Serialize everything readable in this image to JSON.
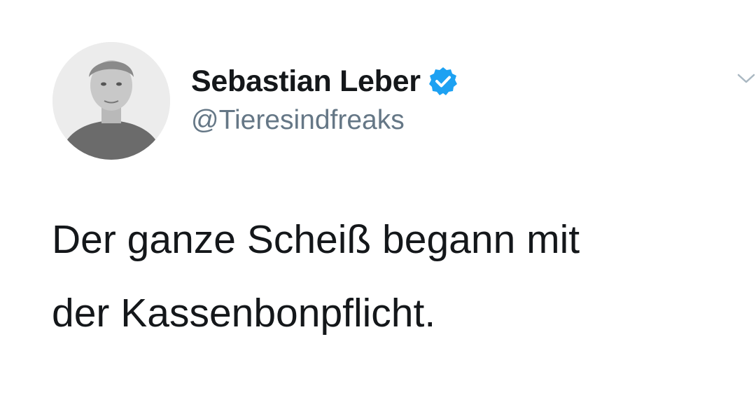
{
  "author": {
    "display_name": "Sebastian Leber",
    "handle": "@Tieresindfreaks",
    "verified": true,
    "avatar_icon": "person-portrait-avatar"
  },
  "tweet": {
    "text_lines": [
      "Der ganze Scheiß begann mit",
      "der Kassenbonpflicht."
    ]
  },
  "icons": {
    "verified": "verified-badge-icon",
    "menu": "chevron-down-icon"
  },
  "colors": {
    "name": "#14171a",
    "handle": "#657786",
    "verified_badge": "#1da1f2",
    "text": "#14171a",
    "background": "#ffffff"
  }
}
